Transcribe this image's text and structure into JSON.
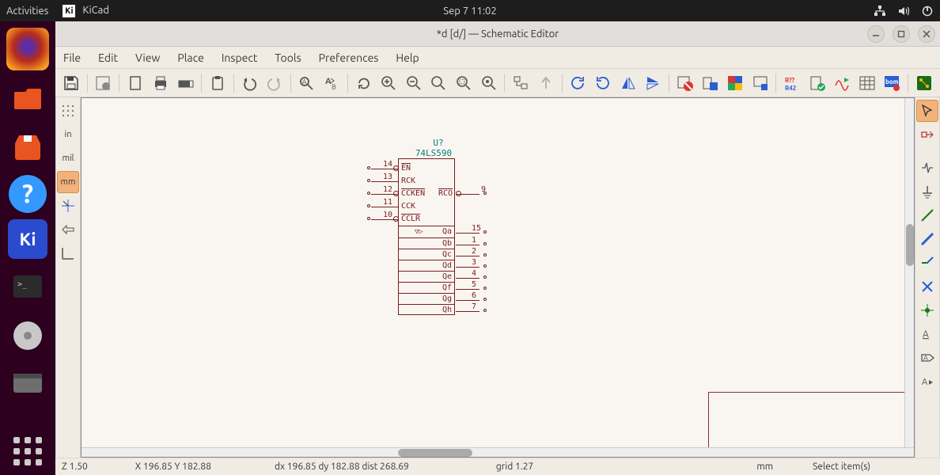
{
  "os_topbar": {
    "activities": "Activities",
    "app_label": "KiCad",
    "clock": "Sep 7  11:02"
  },
  "dock_items": [
    {
      "name": "firefox",
      "bg": "linear-gradient(135deg,#b72c1a 30%,#fca326 90%)"
    },
    {
      "name": "files",
      "bg": "#e95420"
    },
    {
      "name": "software",
      "bg": "#e95420"
    },
    {
      "name": "help",
      "bg": "#3399ff"
    },
    {
      "name": "kicad",
      "bg": "#2b4bcf",
      "active": true,
      "text": "Ki"
    },
    {
      "name": "terminal",
      "bg": "#2b2b2b"
    },
    {
      "name": "disks",
      "bg": "#bfbfbf"
    },
    {
      "name": "shortcut",
      "bg": "#555"
    }
  ],
  "window": {
    "title": "*d [d/] — Schematic Editor"
  },
  "menus": [
    "File",
    "Edit",
    "View",
    "Place",
    "Inspect",
    "Tools",
    "Preferences",
    "Help"
  ],
  "left_tools": [
    {
      "label": "⋮⋮⋮",
      "name": "grid-toggle"
    },
    {
      "label": "in",
      "name": "units-in"
    },
    {
      "label": "mil",
      "name": "units-mil"
    },
    {
      "label": "mm",
      "name": "units-mm",
      "active": true
    },
    {
      "label": "↖",
      "name": "cursor-full"
    },
    {
      "label": "▷",
      "name": "something"
    },
    {
      "label": "└",
      "name": "origin"
    }
  ],
  "right_tools": [
    {
      "name": "select-tool",
      "active": true
    },
    {
      "name": "highlight-net"
    },
    {
      "name": "add-symbol"
    },
    {
      "name": "add-power"
    },
    {
      "name": "add-wire"
    },
    {
      "name": "add-bus"
    },
    {
      "name": "add-bus-entry"
    },
    {
      "name": "no-connect"
    },
    {
      "name": "add-junction"
    },
    {
      "name": "add-label"
    },
    {
      "name": "add-global-label"
    },
    {
      "name": "add-text"
    }
  ],
  "component": {
    "ref": "U?",
    "value": "74LS590",
    "left_pins": [
      {
        "num": "14",
        "name": "EN",
        "neg": true
      },
      {
        "num": "13",
        "name": "RCK"
      },
      {
        "num": "12",
        "name": "CCKEN",
        "neg": true
      },
      {
        "num": "11",
        "name": "CCK"
      },
      {
        "num": "10",
        "name": "CCLR",
        "neg": true
      }
    ],
    "right_top": {
      "num": "9",
      "name": "RCO",
      "neg": true
    },
    "outputs": [
      {
        "name": "Qa",
        "num": "15"
      },
      {
        "name": "Qb",
        "num": "1"
      },
      {
        "name": "Qc",
        "num": "2"
      },
      {
        "name": "Qd",
        "num": "3"
      },
      {
        "name": "Qe",
        "num": "4"
      },
      {
        "name": "Qf",
        "num": "5"
      },
      {
        "name": "Qg",
        "num": "6"
      },
      {
        "name": "Qh",
        "num": "7"
      }
    ]
  },
  "status": {
    "zoom": "Z 1.50",
    "xy": "X 196.85  Y 182.88",
    "dxy": "dx 196.85  dy 182.88  dist 268.69",
    "grid": "grid 1.27",
    "units": "mm",
    "msg": "Select item(s)"
  }
}
